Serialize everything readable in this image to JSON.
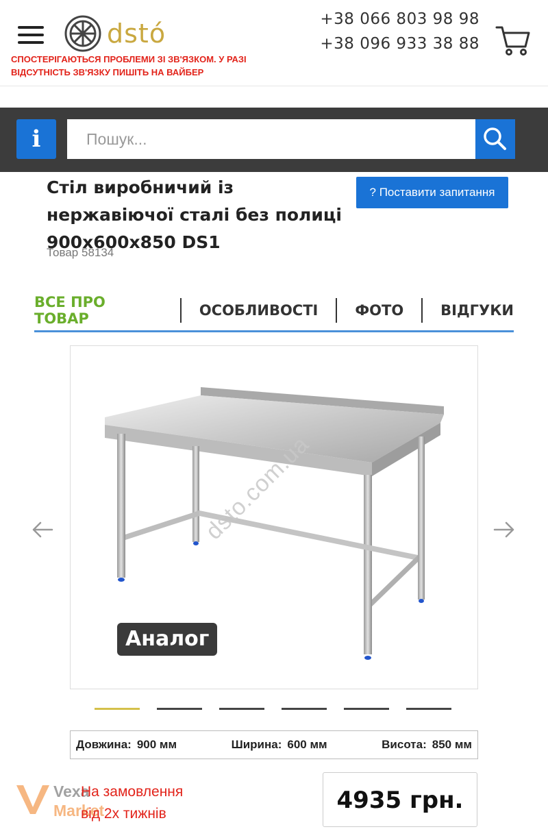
{
  "header": {
    "brand": "dstó",
    "notice": "Спостерігаються проблеми зі зв'язком. У разі відсутність зв'язку пишіть на вайбер",
    "phones": [
      "+38 066 803 98 98",
      "+38 096 933 38 88"
    ],
    "icons": {
      "menu": "hamburger-icon",
      "cart": "cart-icon",
      "logo": "wheel-logo-icon"
    },
    "brand_color": "#c9a840",
    "notice_color": "#e2231a"
  },
  "search": {
    "info_label": "i",
    "placeholder": "Пошук...",
    "icon": "search-icon",
    "accent": "#1a73d6"
  },
  "product": {
    "title": "Стіл виробничий із нержавіючої сталі без полиці 900х600х850 DS1",
    "ask_button": "? Поставити запитання",
    "sku": "Товар 58134"
  },
  "tabs": [
    {
      "label": "Все про товар",
      "active": true
    },
    {
      "label": "Особливості",
      "active": false
    },
    {
      "label": "Фото",
      "active": false
    },
    {
      "label": "Відгуки",
      "active": false
    }
  ],
  "gallery": {
    "badge": "Аналог",
    "watermark": "dsto.com.ua",
    "slides": 6,
    "active_slide": 0
  },
  "dimensions": [
    {
      "label": "Довжина:",
      "value": "900 мм"
    },
    {
      "label": "Ширина:",
      "value": "600 мм"
    },
    {
      "label": "Висота:",
      "value": "850 мм"
    }
  ],
  "availability": {
    "line1": "На замовлення",
    "line2": "від 2х тижнів"
  },
  "price": "4935  грн.",
  "overlay": {
    "vexa_line1": "Vexa",
    "vexa_line2": "Market"
  }
}
